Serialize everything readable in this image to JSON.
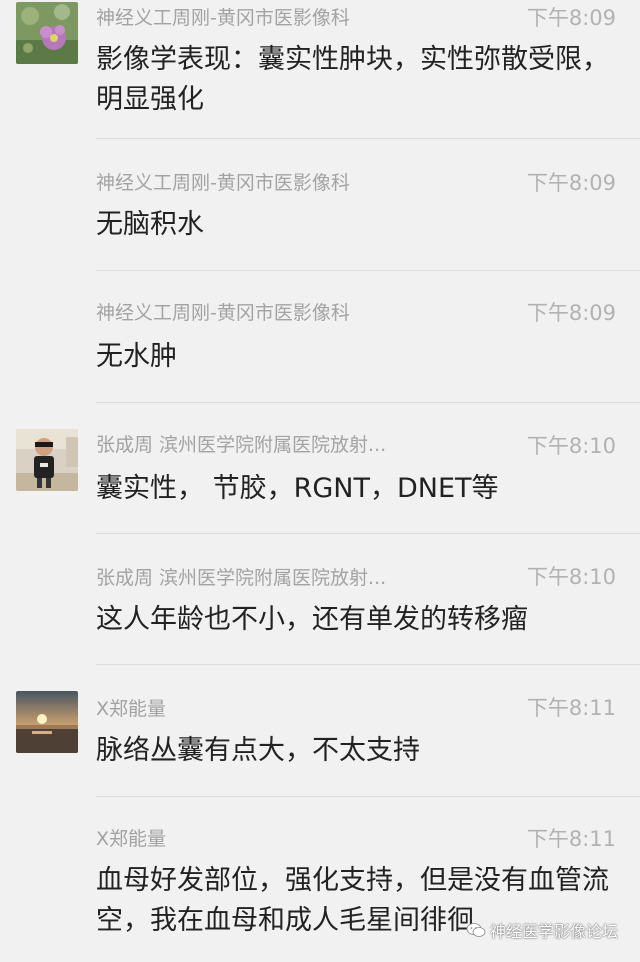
{
  "messages": [
    {
      "sender": "神经义工周刚-黄冈市医影像科",
      "time": "下午8:09",
      "text": "影像学表现：囊实性肿块，实性弥散受限，明显强化",
      "avatar": "flower-avatar"
    },
    {
      "sender": "神经义工周刚-黄冈市医影像科",
      "time": "下午8:09",
      "text": "无脑积水"
    },
    {
      "sender": "神经义工周刚-黄冈市医影像科",
      "time": "下午8:09",
      "text": "无水肿"
    },
    {
      "sender": "张成周 滨州医学院附属医院放射...",
      "time": "下午8:10",
      "text": "囊实性， 节胶，RGNT，DNET等",
      "avatar": "child-avatar"
    },
    {
      "sender": "张成周 滨州医学院附属医院放射...",
      "time": "下午8:10",
      "text": "这人年龄也不小，还有单发的转移瘤"
    },
    {
      "sender": "X郑能量",
      "time": "下午8:11",
      "text": "脉络丛囊有点大，不太支持",
      "avatar": "sunset-avatar"
    },
    {
      "sender": "X郑能量",
      "time": "下午8:11",
      "text": "血母好发部位，强化支持，但是没有血管流空，我在血母和成人毛星间徘徊"
    }
  ],
  "watermark": {
    "text": "神经医学影像论坛",
    "icon": "wechat-icon"
  }
}
